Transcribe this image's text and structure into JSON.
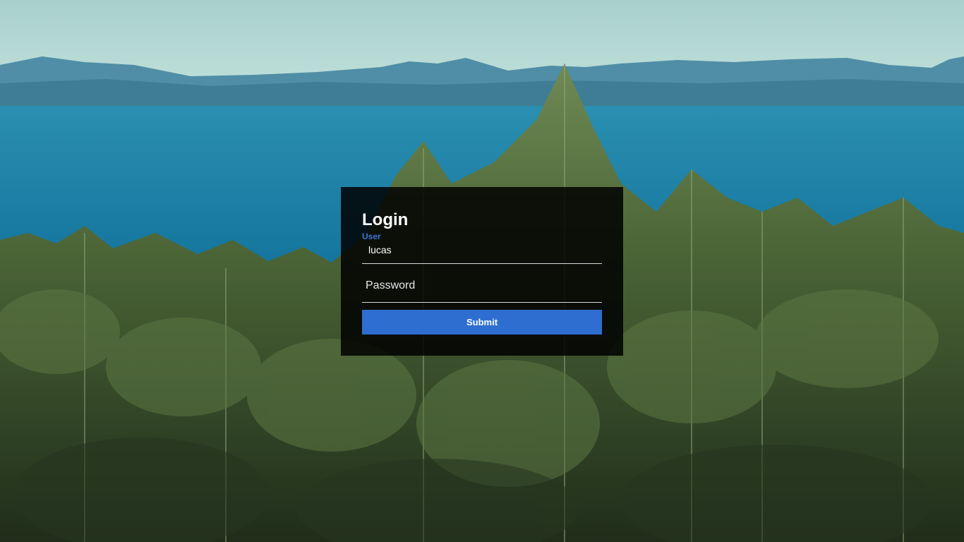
{
  "login": {
    "title": "Login",
    "user_label": "User",
    "user_value": "lucas",
    "password_placeholder": "Password",
    "submit_label": "Submit"
  },
  "colors": {
    "accent": "#2f6ed1",
    "label": "#3a74d8",
    "card_background": "rgba(0,0,0,0.85)"
  },
  "background": {
    "description_icon": "forest-lake-photo"
  }
}
